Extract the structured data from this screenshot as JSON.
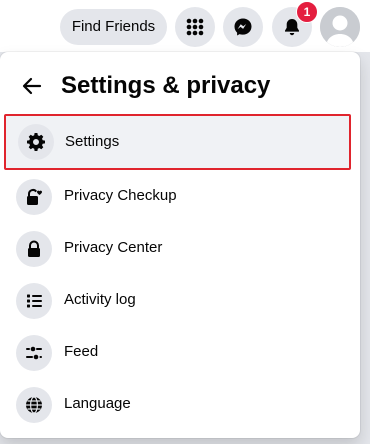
{
  "topbar": {
    "find_friends_label": "Find Friends",
    "notification_count": "1",
    "icons": [
      "menu-grid-icon",
      "messenger-icon",
      "bell-icon",
      "avatar"
    ]
  },
  "panel": {
    "title": "Settings & privacy",
    "items": [
      {
        "label": "Settings",
        "icon": "gear-icon",
        "highlighted": true
      },
      {
        "label": "Privacy Checkup",
        "icon": "lock-heart-icon"
      },
      {
        "label": "Privacy Center",
        "icon": "lock-icon"
      },
      {
        "label": "Activity log",
        "icon": "list-icon"
      },
      {
        "label": "Feed",
        "icon": "sliders-icon"
      },
      {
        "label": "Language",
        "icon": "globe-icon"
      }
    ]
  },
  "colors": {
    "highlight_border": "#e0242d",
    "badge": "#e41e3f",
    "button_bg": "#e4e6eb"
  }
}
